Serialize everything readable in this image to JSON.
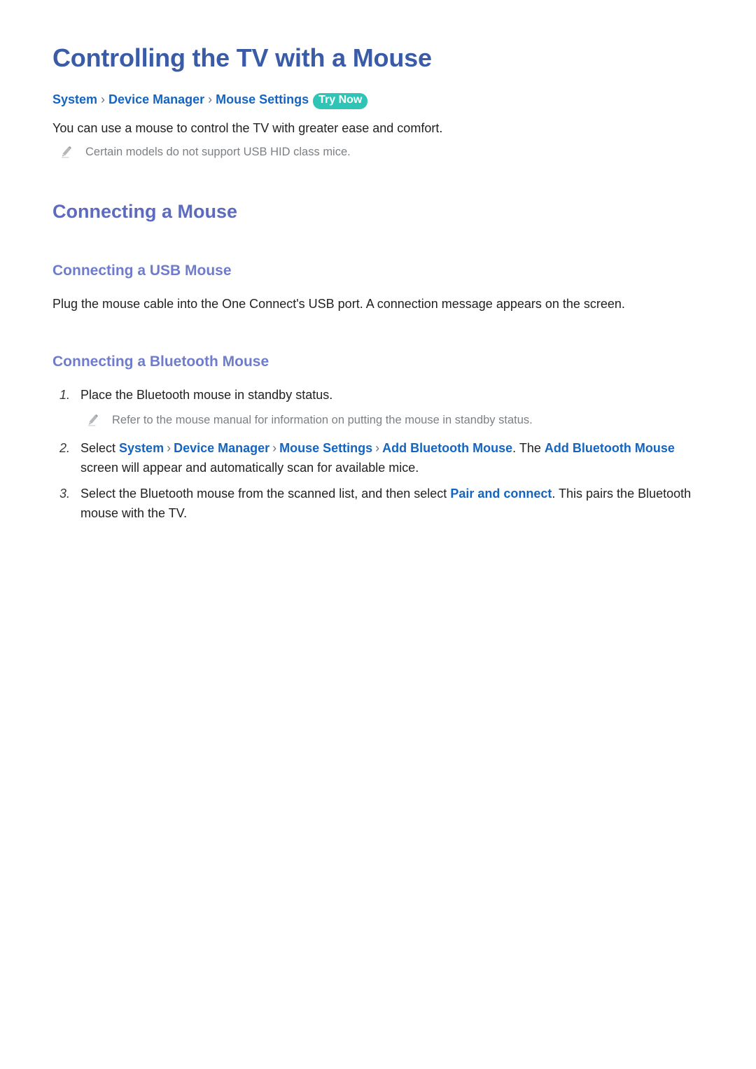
{
  "document": {
    "title": "Controlling the TV with a Mouse",
    "breadcrumb": {
      "items": [
        "System",
        "Device Manager",
        "Mouse Settings"
      ],
      "separator": "›",
      "badge": "Try Now"
    },
    "intro": "You can use a mouse to control the TV with greater ease and comfort.",
    "intro_note": "Certain models do not support USB HID class mice."
  },
  "sections": {
    "connecting_a_mouse": {
      "heading": "Connecting a Mouse",
      "usb": {
        "heading": "Connecting a USB Mouse",
        "paragraph": "Plug the mouse cable into the One Connect's USB port. A connection message appears on the screen."
      },
      "bluetooth": {
        "heading": "Connecting a Bluetooth Mouse",
        "steps": [
          {
            "number": "1.",
            "parts": [
              {
                "text": "Place the Bluetooth mouse in standby status.",
                "style": "plain"
              }
            ],
            "note": "Refer to the mouse manual for information on putting the mouse in standby status."
          },
          {
            "number": "2.",
            "parts": [
              {
                "text": "Select ",
                "style": "plain"
              },
              {
                "text": "System",
                "style": "blue"
              },
              {
                "text": "›",
                "style": "sep"
              },
              {
                "text": "Device Manager",
                "style": "blue"
              },
              {
                "text": "›",
                "style": "sep"
              },
              {
                "text": "Mouse Settings",
                "style": "blue"
              },
              {
                "text": "›",
                "style": "sep"
              },
              {
                "text": "Add Bluetooth Mouse",
                "style": "blue"
              },
              {
                "text": ". The ",
                "style": "plain"
              },
              {
                "text": "Add Bluetooth Mouse",
                "style": "blue"
              },
              {
                "text": " screen will appear and automatically scan for available mice.",
                "style": "plain"
              }
            ],
            "note": ""
          },
          {
            "number": "3.",
            "parts": [
              {
                "text": "Select the Bluetooth mouse from the scanned list, and then select ",
                "style": "plain"
              },
              {
                "text": "Pair and connect",
                "style": "blue"
              },
              {
                "text": ". This pairs the Bluetooth mouse with the TV.",
                "style": "plain"
              }
            ],
            "note": ""
          }
        ]
      }
    }
  },
  "colors": {
    "title_blue": "#3a5ba8",
    "link_blue": "#1565c0",
    "heading_purple": "#5c6bc0",
    "subheading_purple": "#6f7ccb",
    "badge_teal": "#2ec4b6",
    "note_gray": "#7c8085",
    "body_text": "#222222"
  },
  "icons": {
    "pencil": "pencil-icon"
  }
}
